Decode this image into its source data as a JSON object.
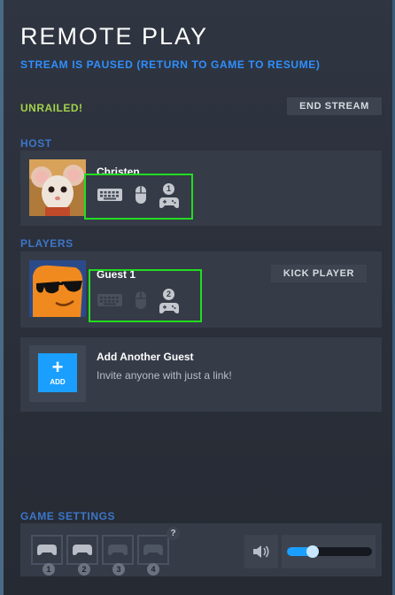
{
  "header": {
    "title": "REMOTE PLAY",
    "subtitle": "STREAM IS PAUSED (RETURN TO GAME TO RESUME)",
    "game": "UNRAILED!",
    "end_stream_label": "END STREAM"
  },
  "host": {
    "section_label": "HOST",
    "name": "Christen",
    "controller_number": "1"
  },
  "players": {
    "section_label": "PLAYERS",
    "list": [
      {
        "name": "Guest 1",
        "controller_number": "2",
        "kick_label": "KICK PLAYER"
      }
    ]
  },
  "add_guest": {
    "button_label": "ADD",
    "title": "Add Another Guest",
    "subtitle": "Invite anyone with just a link!"
  },
  "game_settings": {
    "section_label": "GAME SETTINGS",
    "slots": [
      "1",
      "2",
      "3",
      "4"
    ],
    "help_label": "?",
    "volume_level": 0.3
  },
  "colors": {
    "accent": "#1a9fff",
    "game_title": "#a3d14a",
    "section": "#3c76c8",
    "highlight": "#22dd22"
  },
  "icons": [
    "keyboard-icon",
    "mouse-icon",
    "gamepad-icon",
    "speaker-icon",
    "plus-icon",
    "help-icon"
  ]
}
